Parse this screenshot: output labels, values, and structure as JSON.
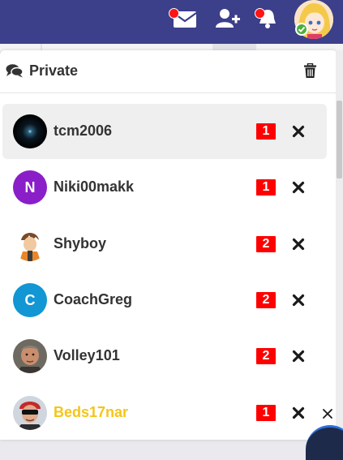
{
  "panel": {
    "title": "Private",
    "conversations": [
      {
        "name": "tcm2006",
        "unread": "1",
        "avatar_letter": "",
        "avatar_kind": "dark-orb",
        "name_color": "#333333",
        "active": true
      },
      {
        "name": "Niki00makk",
        "unread": "1",
        "avatar_letter": "N",
        "avatar_kind": "letter",
        "avatar_color": "#8a1ec8",
        "name_color": "#333333",
        "active": false
      },
      {
        "name": "Shyboy",
        "unread": "2",
        "avatar_letter": "",
        "avatar_kind": "anime-figure",
        "name_color": "#333333",
        "active": false
      },
      {
        "name": "CoachGreg",
        "unread": "2",
        "avatar_letter": "C",
        "avatar_kind": "letter",
        "avatar_color": "#1296d4",
        "name_color": "#333333",
        "active": false
      },
      {
        "name": "Volley101",
        "unread": "2",
        "avatar_letter": "",
        "avatar_kind": "photo",
        "name_color": "#333333",
        "active": false
      },
      {
        "name": "Beds17nar",
        "unread": "1",
        "avatar_letter": "",
        "avatar_kind": "photo-sunglasses",
        "name_color": "#f5c518",
        "active": false
      }
    ]
  },
  "topbar": {
    "icons": [
      "mail-icon",
      "add-friend-icon",
      "bell-icon"
    ],
    "notification_color": "#ff1414",
    "background": "#3c3f8a"
  },
  "colors": {
    "badge": "#ff0000",
    "online": "#4caf3a"
  }
}
